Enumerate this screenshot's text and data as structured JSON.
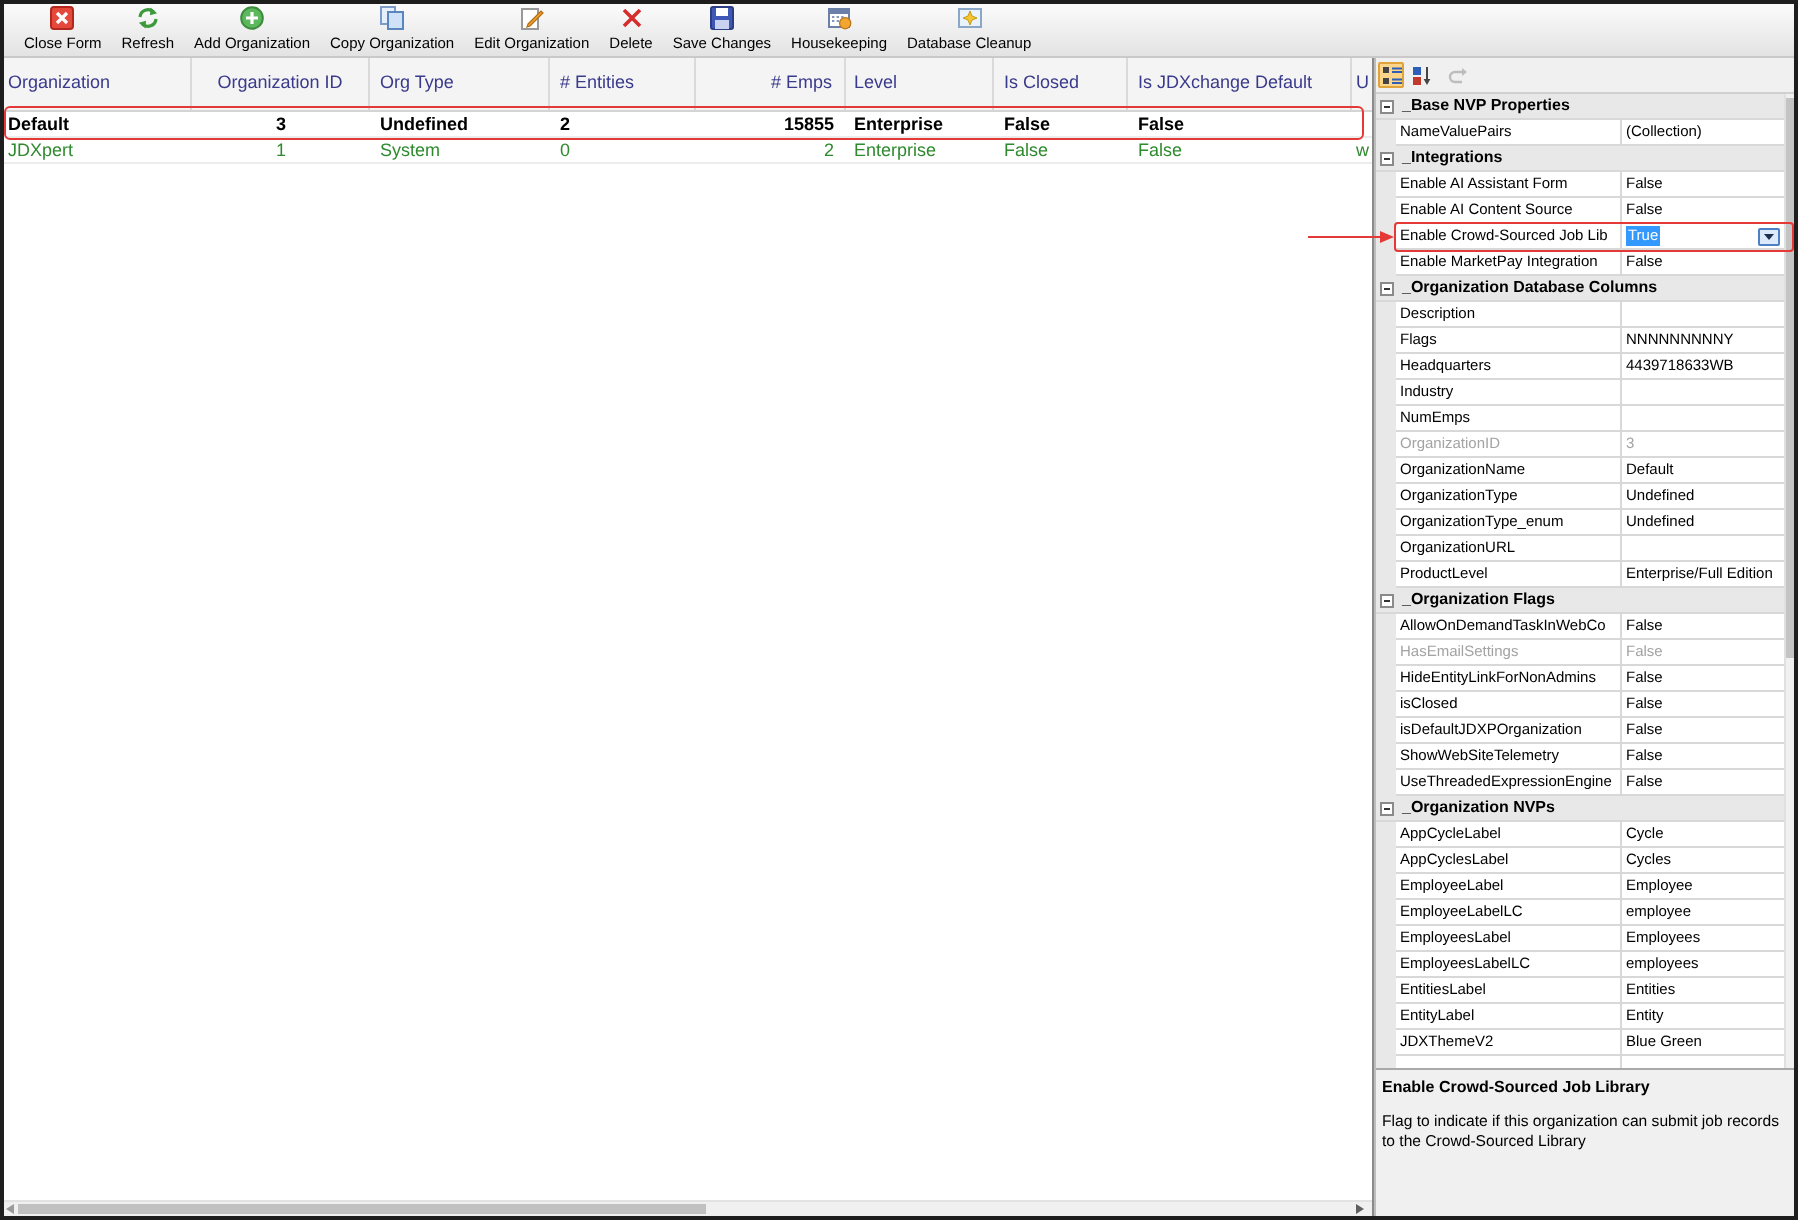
{
  "toolbar": [
    {
      "kind": "close",
      "label": "Close Form"
    },
    {
      "kind": "refresh",
      "label": "Refresh"
    },
    {
      "kind": "add",
      "label": "Add Organization"
    },
    {
      "kind": "copy",
      "label": "Copy Organization"
    },
    {
      "kind": "edit",
      "label": "Edit Organization"
    },
    {
      "kind": "delete",
      "label": "Delete"
    },
    {
      "kind": "save",
      "label": "Save Changes"
    },
    {
      "kind": "housekeeping",
      "label": "Housekeeping"
    },
    {
      "kind": "cleanup",
      "label": "Database Cleanup"
    }
  ],
  "table": {
    "columns": [
      "Organization",
      "Organization ID",
      "Org Type",
      "# Entities",
      "# Emps",
      "Level",
      "Is Closed",
      "Is JDXchange Default",
      "U"
    ],
    "rows": [
      {
        "selected": true,
        "highlighted": true,
        "color": "#000000",
        "cells": [
          "Default",
          "3",
          "Undefined",
          "2",
          "15855",
          "Enterprise",
          "False",
          "False"
        ]
      },
      {
        "selected": false,
        "highlighted": false,
        "color": "#2f8a2f",
        "cells": [
          "JDXpert",
          "1",
          "System",
          "0",
          "2",
          "Enterprise",
          "False",
          "False",
          "w"
        ]
      }
    ]
  },
  "property_grid": {
    "toolbar": [
      {
        "kind": "categorized",
        "selected": true,
        "disabled": false
      },
      {
        "kind": "alphabetical",
        "selected": false,
        "disabled": false
      },
      {
        "kind": "property-pages",
        "selected": false,
        "disabled": true
      }
    ],
    "categories": [
      {
        "title": "_Base NVP Properties",
        "expanded": true,
        "properties": [
          {
            "name": "NameValuePairs",
            "value": "(Collection)",
            "disabled": false,
            "selected": false,
            "highlighted": false
          }
        ]
      },
      {
        "title": "_Integrations",
        "expanded": true,
        "properties": [
          {
            "name": "Enable AI Assistant Form",
            "value": "False",
            "disabled": false,
            "selected": false,
            "highlighted": false
          },
          {
            "name": "Enable AI Content Source",
            "value": "False",
            "disabled": false,
            "selected": false,
            "highlighted": false
          },
          {
            "name": "Enable Crowd-Sourced Job Lib",
            "value": "True",
            "disabled": false,
            "selected": true,
            "highlighted": true
          },
          {
            "name": "Enable MarketPay Integration",
            "value": "False",
            "disabled": false,
            "selected": false,
            "highlighted": false
          }
        ]
      },
      {
        "title": "_Organization Database Columns",
        "expanded": true,
        "properties": [
          {
            "name": "Description",
            "disabled": false,
            "selected": false,
            "highlighted": false
          },
          {
            "name": "Flags",
            "value": "NNNNNNNNNY",
            "disabled": false,
            "selected": false,
            "highlighted": false
          },
          {
            "name": "Headquarters",
            "value": "4439718633WB",
            "disabled": false,
            "selected": false,
            "highlighted": false
          },
          {
            "name": "Industry",
            "disabled": false,
            "selected": false,
            "highlighted": false
          },
          {
            "name": "NumEmps",
            "disabled": false,
            "selected": false,
            "highlighted": false
          },
          {
            "name": "OrganizationID",
            "value": "3",
            "disabled": true,
            "selected": false,
            "highlighted": false
          },
          {
            "name": "OrganizationName",
            "value": "Default",
            "disabled": false,
            "selected": false,
            "highlighted": false
          },
          {
            "name": "OrganizationType",
            "value": "Undefined",
            "disabled": false,
            "selected": false,
            "highlighted": false
          },
          {
            "name": "OrganizationType_enum",
            "value": "Undefined",
            "disabled": false,
            "selected": false,
            "highlighted": false
          },
          {
            "name": "OrganizationURL",
            "disabled": false,
            "selected": false,
            "highlighted": false
          },
          {
            "name": "ProductLevel",
            "value": "Enterprise/Full Edition",
            "disabled": false,
            "selected": false,
            "highlighted": false
          }
        ]
      },
      {
        "title": "_Organization Flags",
        "expanded": true,
        "properties": [
          {
            "name": "AllowOnDemandTaskInWebCo",
            "value": "False",
            "disabled": false,
            "selected": false,
            "highlighted": false
          },
          {
            "name": "HasEmailSettings",
            "value": "False",
            "disabled": true,
            "selected": false,
            "highlighted": false
          },
          {
            "name": "HideEntityLinkForNonAdmins",
            "value": "False",
            "disabled": false,
            "selected": false,
            "highlighted": false
          },
          {
            "name": "isClosed",
            "value": "False",
            "disabled": false,
            "selected": false,
            "highlighted": false
          },
          {
            "name": "isDefaultJDXPOrganization",
            "value": "False",
            "disabled": false,
            "selected": false,
            "highlighted": false
          },
          {
            "name": "ShowWebSiteTelemetry",
            "value": "False",
            "disabled": false,
            "selected": false,
            "highlighted": false
          },
          {
            "name": "UseThreadedExpressionEngine",
            "value": "False",
            "disabled": false,
            "selected": false,
            "highlighted": false
          }
        ]
      },
      {
        "title": "_Organization NVPs",
        "expanded": true,
        "properties": [
          {
            "name": "AppCycleLabel",
            "value": "Cycle",
            "disabled": false,
            "selected": false,
            "highlighted": false
          },
          {
            "name": "AppCyclesLabel",
            "value": "Cycles",
            "disabled": false,
            "selected": false,
            "highlighted": false
          },
          {
            "name": "EmployeeLabel",
            "value": "Employee",
            "disabled": false,
            "selected": false,
            "highlighted": false
          },
          {
            "name": "EmployeeLabelLC",
            "value": "employee",
            "disabled": false,
            "selected": false,
            "highlighted": false
          },
          {
            "name": "EmployeesLabel",
            "value": "Employees",
            "disabled": false,
            "selected": false,
            "highlighted": false
          },
          {
            "name": "EmployeesLabelLC",
            "value": "employees",
            "disabled": false,
            "selected": false,
            "highlighted": false
          },
          {
            "name": "EntitiesLabel",
            "value": "Entities",
            "disabled": false,
            "selected": false,
            "highlighted": false
          },
          {
            "name": "EntityLabel",
            "value": "Entity",
            "disabled": false,
            "selected": false,
            "highlighted": false
          },
          {
            "name": "JDXThemeV2",
            "value": "Blue Green",
            "disabled": false,
            "selected": false,
            "highlighted": false
          }
        ]
      }
    ],
    "help": {
      "title": "Enable Crowd-Sourced Job Library",
      "description": "Flag to indicate if this organization can submit job records to the Crowd-Sourced Library"
    }
  }
}
